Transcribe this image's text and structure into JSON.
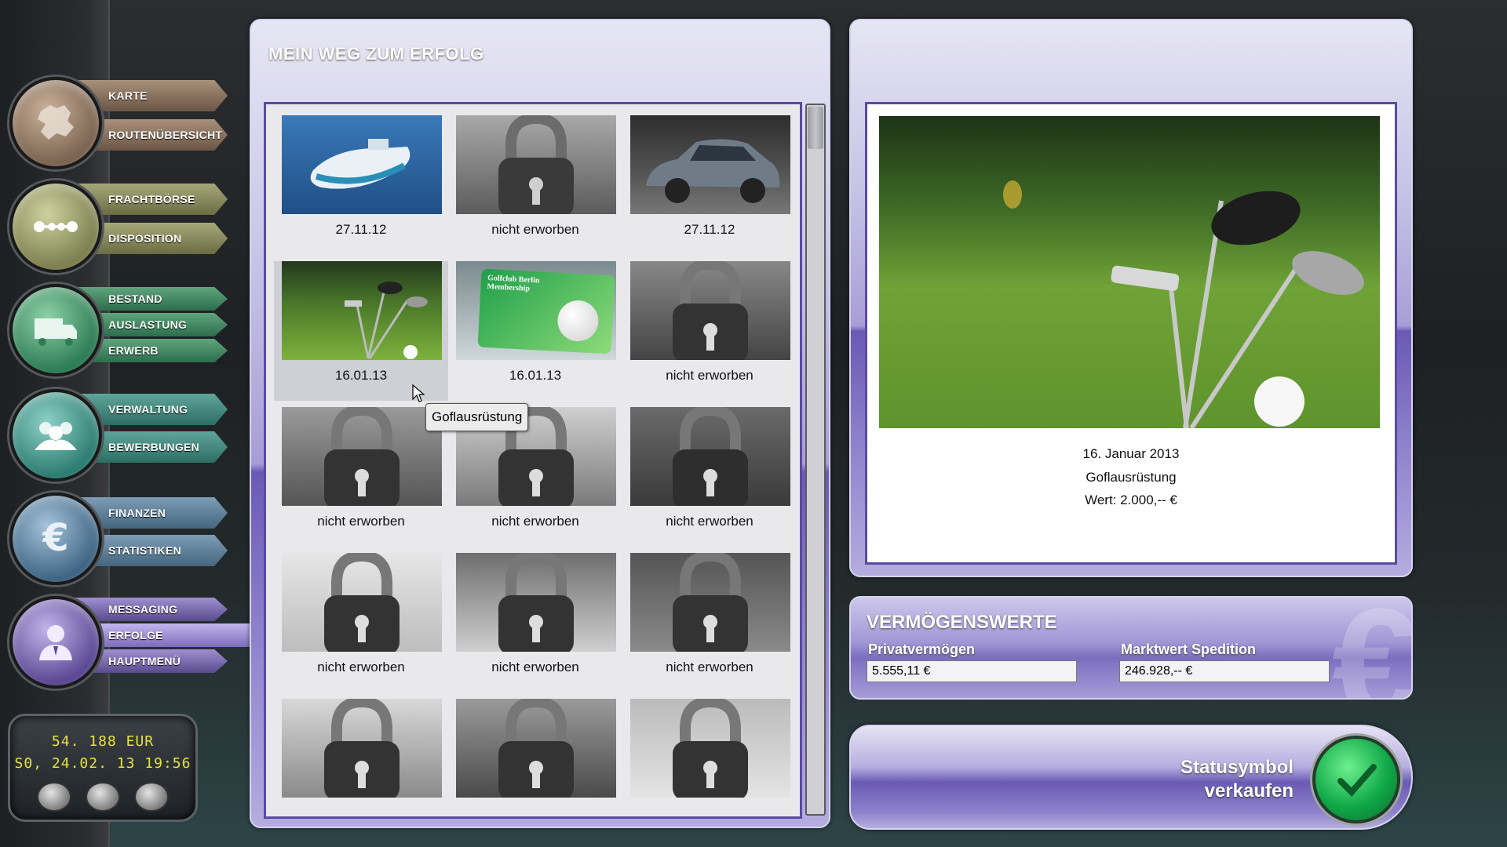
{
  "nav": {
    "karte": {
      "items": [
        "KARTE",
        "ROUTENÜBERSICHT"
      ],
      "icon": "europe-map-icon"
    },
    "fracht": {
      "items": [
        "FRACHTBÖRSE",
        "DISPOSITION"
      ],
      "icon": "route-dots-icon"
    },
    "bestand": {
      "items": [
        "BESTAND",
        "AUSLASTUNG",
        "ERWERB"
      ],
      "icon": "truck-icon"
    },
    "verwaltung": {
      "items": [
        "VERWALTUNG",
        "BEWERBUNGEN"
      ],
      "icon": "people-icon"
    },
    "finanzen": {
      "items": [
        "FINANZEN",
        "STATISTIKEN"
      ],
      "icon": "euro-icon"
    },
    "messaging": {
      "items": [
        "MESSAGING",
        "ERFOLGE",
        "HAUPTMENÜ"
      ],
      "icon": "person-icon",
      "active": "ERFOLGE"
    }
  },
  "clock": {
    "money": "54. 188 EUR",
    "datetime": "S0, 24.02. 13 19:56"
  },
  "gallery": {
    "title": "MEIN WEG ZUM ERFOLG",
    "items": [
      {
        "caption": "27.11.12",
        "image": "dinghy-boat",
        "locked": false
      },
      {
        "caption": "nicht erworben",
        "image": "locked",
        "locked": true
      },
      {
        "caption": "27.11.12",
        "image": "silver-car",
        "locked": false
      },
      {
        "caption": "16.01.13",
        "image": "golf-clubs",
        "locked": false
      },
      {
        "caption": "16.01.13",
        "image": "golfclub-membership-card",
        "locked": false
      },
      {
        "caption": "nicht erworben",
        "image": "locked",
        "locked": true
      },
      {
        "caption": "nicht erworben",
        "image": "locked",
        "locked": true
      },
      {
        "caption": "nicht erworben",
        "image": "locked",
        "locked": true
      },
      {
        "caption": "nicht erworben",
        "image": "locked",
        "locked": true
      },
      {
        "caption": "nicht erworben",
        "image": "locked",
        "locked": true
      },
      {
        "caption": "nicht erworben",
        "image": "locked",
        "locked": true
      },
      {
        "caption": "nicht erworben",
        "image": "locked",
        "locked": true
      },
      {
        "caption": "",
        "image": "locked",
        "locked": true
      },
      {
        "caption": "",
        "image": "locked",
        "locked": true
      },
      {
        "caption": "",
        "image": "locked",
        "locked": true
      }
    ],
    "card_text": "Golfclub Berlin Membership",
    "tooltip": "Goflausrüstung"
  },
  "detail": {
    "date": "16. Januar 2013",
    "name": "Goflausrüstung",
    "value": "Wert: 2.000,-- €"
  },
  "assets": {
    "title": "VERMÖGENSWERTE",
    "private_label": "Privatvermögen",
    "private_value": "5.555,11 €",
    "market_label": "Marktwert Spedition",
    "market_value": "246.928,-- €"
  },
  "sell": {
    "line1": "Statusymbol",
    "line2": "verkaufen"
  },
  "colors": {
    "accent": "#5b4aa3",
    "clock_text": "#e8e23c",
    "ok_green": "#10a848"
  }
}
